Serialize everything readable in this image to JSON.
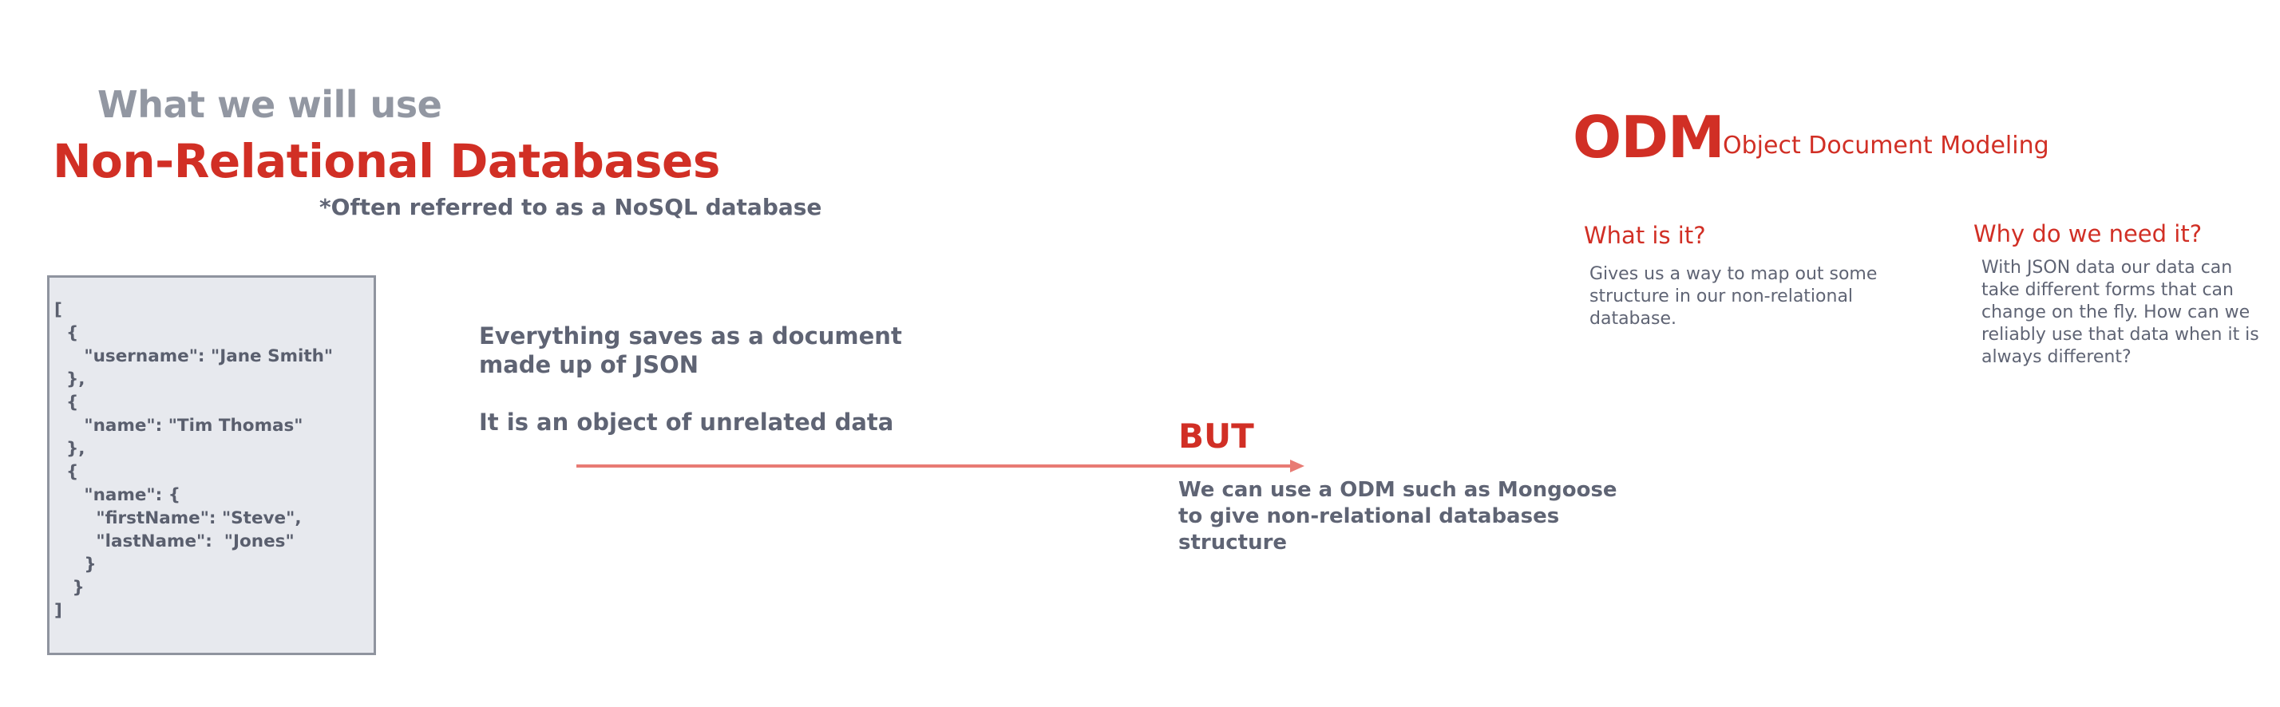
{
  "left_panel": {
    "eyebrow": "What we will use",
    "title": "Non-Relational Databases",
    "note": "*Often referred to as a NoSQL database",
    "json_example_lines": [
      "[",
      "  {",
      "     \"username\": \"Jane Smith\"",
      "  },",
      "  {",
      "     \"name\": \"Tim Thomas\"",
      "  },",
      "  {",
      "     \"name\": {",
      "       \"firstName\": \"Steve\",",
      "       \"lastName\":  \"Jones\"",
      "     }",
      "   }",
      "]"
    ]
  },
  "middle_panel": {
    "statement_lines": [
      "Everything saves as a document",
      "made up of JSON"
    ],
    "statement2": "It is an object of unrelated data",
    "but_label": "BUT",
    "but_lines": [
      "We can use a ODM such as Mongoose",
      "to give non-relational databases",
      "structure"
    ]
  },
  "right_panel": {
    "acronym": "ODM",
    "acronym_expansion": "Object Document Modeling",
    "what_heading": "What is it?",
    "what_lines": [
      "Gives us a way to map out some",
      "structure in our non-relational",
      "database."
    ],
    "why_heading": "Why do we need it?",
    "why_lines": [
      "With JSON data our data can",
      "take different forms that can",
      "change on the fly. How can we",
      "reliably use that data when it is",
      "always different?"
    ]
  },
  "colors": {
    "accent_red": "#d12f25",
    "muted_gray": "#9297a2",
    "body_text": "#5f6474",
    "box_fill": "#e7e9ee",
    "arrow": "#e87b74"
  }
}
